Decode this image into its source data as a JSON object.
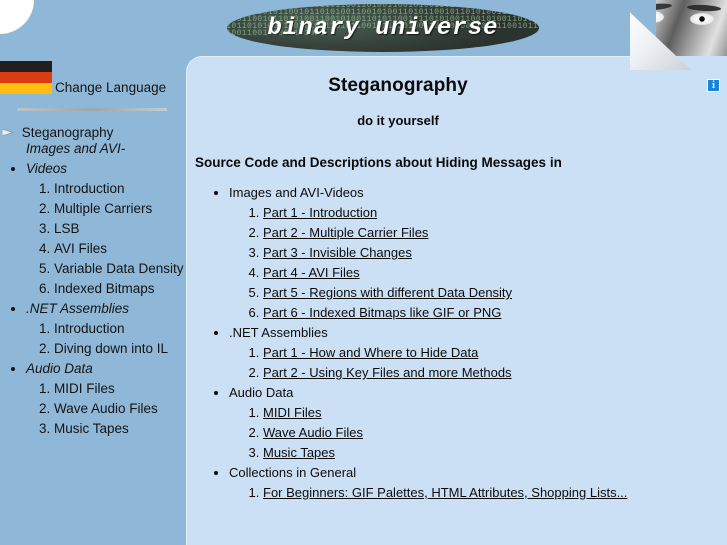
{
  "site": {
    "logo_text": "binary universe",
    "logo_bits": "01001011010011100001101100110100110010100110101100101101010011001010011010110010110101001100101001101011001011010100110010100110101100101101010011001010011010110010110101001100101001101011001011010100110010100110101100101101010011001010011010110010110101001100101001101011",
    "logo_ellipse_color": "#37443c",
    "page_bg": "#8fb8d8",
    "content_bg": "#cce0f5"
  },
  "icons": {
    "info": "i",
    "info_icon_color": "#1884d8",
    "face_photo": "face-eyes-photo",
    "page_curl": "page-curl"
  },
  "sidebar": {
    "flag": {
      "name": "german-flag",
      "bands": [
        "#231f20",
        "#dd3b12",
        "#fdbe10"
      ]
    },
    "change_language": "Change Language",
    "root_item": "Steganography",
    "groups": [
      {
        "label": "Images and AVI-Videos",
        "items": [
          "Introduction",
          "Multiple Carriers",
          "LSB",
          "AVI Files",
          "Variable Data Density",
          "Indexed Bitmaps"
        ]
      },
      {
        "label": ".NET Assemblies",
        "items": [
          "Introduction",
          "Diving down into IL"
        ]
      },
      {
        "label": "Audio Data",
        "items": [
          "MIDI Files",
          "Wave Audio Files",
          "Music Tapes"
        ]
      }
    ]
  },
  "content": {
    "title": "Steganography",
    "subtitle": "do it yourself",
    "lead": "Source Code and Descriptions about Hiding Messages in",
    "groups": [
      {
        "label": "Images and AVI-Videos",
        "links": [
          "Part 1 - Introduction",
          "Part 2 - Multiple Carrier Files",
          "Part 3 - Invisible Changes",
          "Part 4 - AVI Files",
          "Part 5 - Regions with different Data Density",
          "Part 6 - Indexed Bitmaps like GIF or PNG"
        ]
      },
      {
        "label": ".NET Assemblies",
        "links": [
          "Part 1 - How and Where to Hide Data",
          "Part 2 - Using Key Files and more Methods"
        ]
      },
      {
        "label": "Audio Data",
        "links": [
          "MIDI Files",
          "Wave Audio Files",
          "Music Tapes"
        ]
      },
      {
        "label": "Collections in General",
        "links": [
          "For Beginners: GIF Palettes, HTML Attributes, Shopping Lists..."
        ]
      }
    ]
  }
}
